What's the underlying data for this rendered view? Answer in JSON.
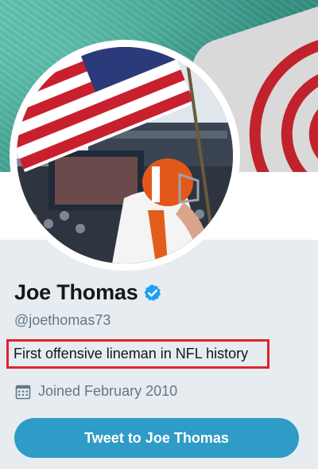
{
  "profile": {
    "name": "Joe Thomas",
    "handle": "@joethomas73",
    "bio": "First offensive lineman in NFL history",
    "joined": "Joined February 2010",
    "verified": true
  },
  "actions": {
    "tweet_to_label": "Tweet to Joe Thomas"
  },
  "icons": {
    "verified": "verified-badge-icon",
    "calendar": "calendar-icon"
  },
  "colors": {
    "accent": "#2f9bc7",
    "verified_blue": "#1da1f2",
    "highlight_box": "#e0232e",
    "text_primary": "#14171a",
    "text_secondary": "#657786",
    "background": "#e6ecf0"
  }
}
